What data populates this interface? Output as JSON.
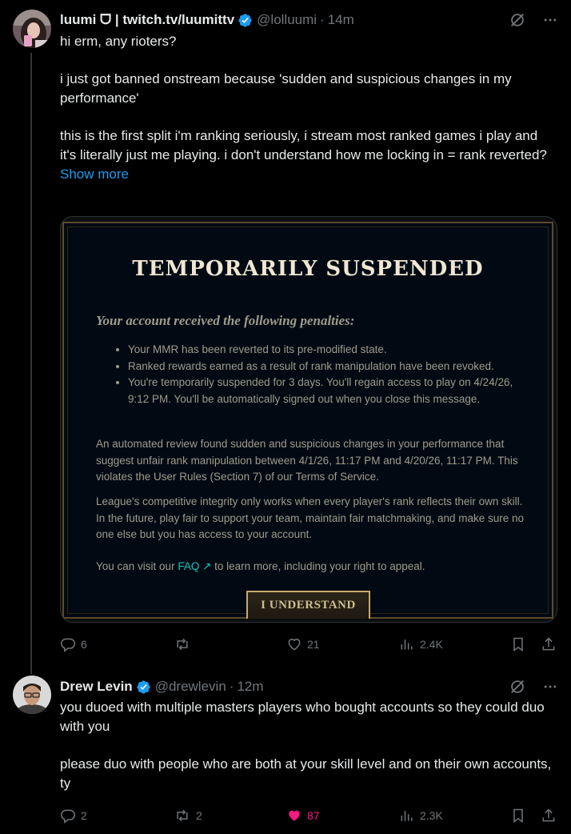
{
  "post1": {
    "display_name": "luumi ᗜ | twitch.tv/luumittv",
    "handle": "@lolluumi",
    "time": "14m",
    "text_line1": "hi erm, any rioters?",
    "text_para2": "i just got banned onstream because 'sudden and suspicious changes in my performance'",
    "text_para3": "this is the first split i'm ranking seriously, i stream most ranked games i play and it's literally just me playing. i don't understand how me locking in = rank reverted?",
    "show_more": "Show more",
    "media": {
      "title": "TEMPORARILY SUSPENDED",
      "subtitle": "Your account received the following penalties:",
      "penalties": [
        "Your MMR has been reverted to its pre-modified state.",
        "Ranked rewards earned as a result of rank manipulation have been revoked.",
        "You're temporarily suspended for 3 days. You'll regain access to play on 4/24/26, 9:12 PM. You'll be automatically signed out when you close this message."
      ],
      "para1": "An automated review found sudden and suspicious changes in your performance that suggest unfair rank manipulation between 4/1/26, 11:17 PM and 4/20/26, 11:17 PM. This violates the User Rules (Section 7) of our Terms of Service.",
      "para2": "League's competitive integrity only works when every player's rank reflects their own skill. In the future, play fair to support your team, maintain fair matchmaking, and make sure no one else but you has access to your account.",
      "para3_before": "You can visit our ",
      "para3_link": "FAQ ↗",
      "para3_after": " to learn more, including your right to appeal.",
      "button": "I UNDERSTAND"
    },
    "actions": {
      "replies": "6",
      "reposts": "",
      "likes": "21",
      "views": "2.4K"
    }
  },
  "post2": {
    "display_name": "Drew Levin",
    "handle": "@drewlevin",
    "time": "12m",
    "text_para1": "you duoed with multiple masters players who bought accounts so they could duo with you",
    "text_para2": "please duo with people who are both at your skill level and on their own accounts, ty",
    "actions": {
      "replies": "2",
      "reposts": "2",
      "likes": "87",
      "views": "2.3K"
    }
  },
  "colors": {
    "accent": "#1d9bf0",
    "like": "#f91880",
    "muted": "#71767b",
    "verified": "#1d9bf0"
  },
  "separator_dot": "·"
}
